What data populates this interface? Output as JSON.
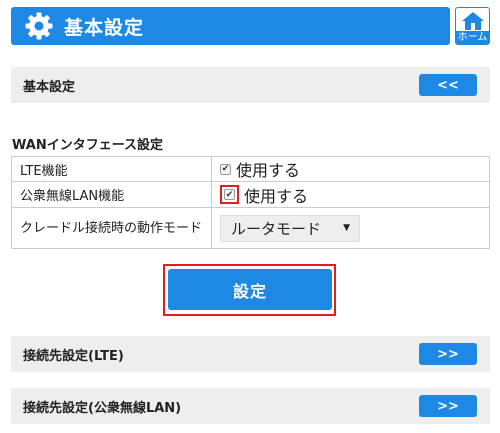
{
  "header": {
    "title": "基本設定",
    "home_label": "ホーム"
  },
  "section_basic": {
    "label": "基本設定",
    "button_label": "<<"
  },
  "wan": {
    "heading": "WANインタフェース設定",
    "rows": [
      {
        "label": "LTE機能",
        "checked": true,
        "value_text": "使用する"
      },
      {
        "label": "公衆無線LAN機能",
        "checked": true,
        "value_text": "使用する"
      },
      {
        "label": "クレードル接続時の動作モード",
        "select_value": "ルータモード"
      }
    ]
  },
  "submit_label": "設定",
  "section_lte": {
    "label": "接続先設定(LTE)",
    "button_label": ">>"
  },
  "section_wlan": {
    "label": "接続先設定(公衆無線LAN)",
    "button_label": ">>"
  },
  "colors": {
    "accent": "#1e88e5",
    "highlight": "#e02020",
    "bar_bg": "#eeeeee"
  },
  "icons": {
    "header": "gear-icon",
    "home": "home-icon",
    "select": "dropdown-arrow-icon"
  }
}
